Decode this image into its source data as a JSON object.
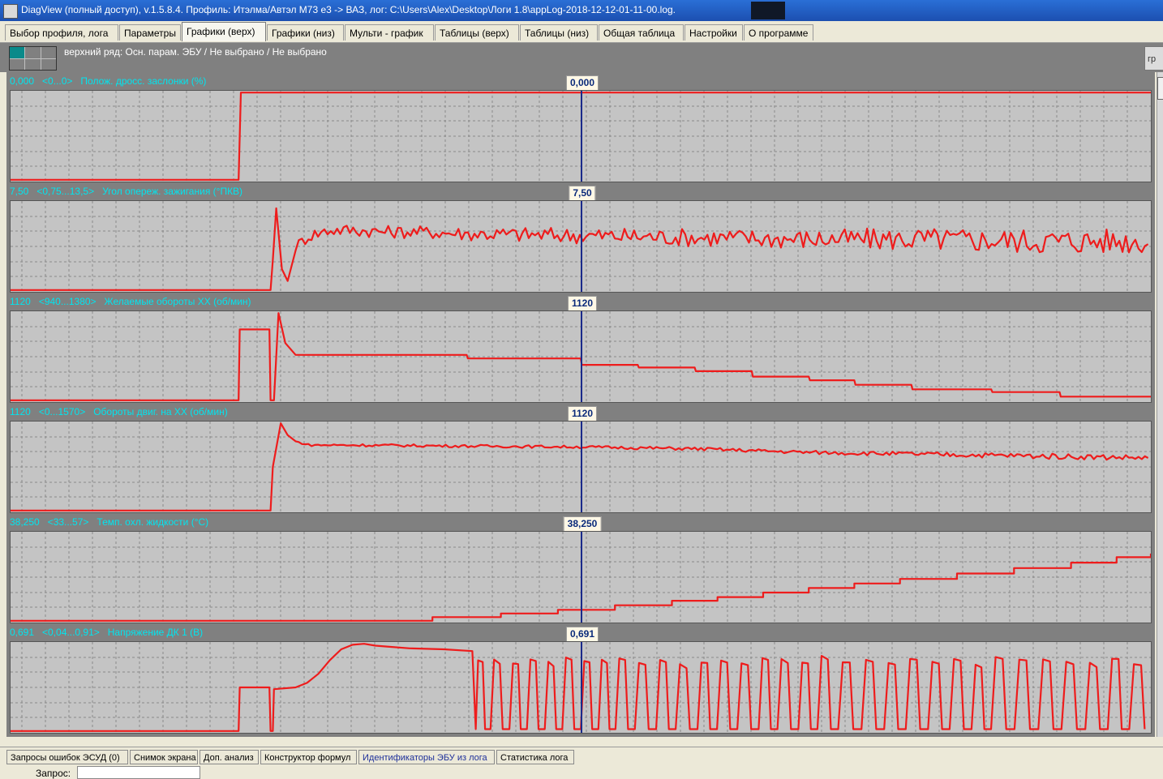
{
  "window": {
    "title": "DiagView (полный доступ), v.1.5.8.4. Профиль: Итэлма/Автэл M73 е3 -> ВАЗ,   лог: C:\\Users\\Alex\\Desktop\\Логи 1.8\\appLog-2018-12-12-01-11-00.log."
  },
  "tabs": [
    {
      "label": "Выбор профиля, лога"
    },
    {
      "label": "Параметры"
    },
    {
      "label": "Графики (верх)",
      "active": true
    },
    {
      "label": "Графики (низ)"
    },
    {
      "label": "Мульти - график"
    },
    {
      "label": "Таблицы (верх)"
    },
    {
      "label": "Таблицы (низ)"
    },
    {
      "label": "Общая таблица"
    },
    {
      "label": "Настройки"
    },
    {
      "label": "О программе"
    }
  ],
  "toolbar": {
    "row_label": "верхний ряд: Осн. парам. ЭБУ / Не выбрано / Не выбрано",
    "right_button": "гр"
  },
  "colors": {
    "trace": "#ee1c1c",
    "cursor": "#1a2a8a",
    "header_text": "#00e5ef",
    "plot_bg": "#c4c4c4",
    "grid": "#8a8a8a"
  },
  "chart_data": {
    "type": "line",
    "cursor_position": 0.5,
    "grid": true,
    "series": [
      {
        "value_text": "0,000",
        "range_text": "<0...0>",
        "name": "Полож. дросс. заслонки (%)",
        "cursor_value": "0,000",
        "x": [
          0,
          0.2,
          0.202,
          1
        ],
        "y": [
          0.02,
          0.02,
          0.98,
          0.98
        ]
      },
      {
        "value_text": "7,50",
        "range_text": "<0,75...13,5>",
        "name": "Угол опереж. зажигания (°ПКВ)",
        "cursor_value": "7,50",
        "x": [
          0,
          0.228,
          0.23,
          0.233,
          0.238,
          0.243,
          0.25,
          0.262,
          0.28,
          0.3,
          0.33,
          0.36,
          0.4,
          0.5,
          0.6,
          0.7,
          0.8,
          0.9,
          1
        ],
        "y": [
          0.02,
          0.02,
          0.35,
          0.92,
          0.25,
          0.12,
          0.5,
          0.62,
          0.68,
          0.68,
          0.66,
          0.66,
          0.64,
          0.62,
          0.6,
          0.58,
          0.58,
          0.56,
          0.56
        ],
        "noise": [
          0,
          0,
          0,
          0,
          0,
          0,
          0.06,
          0.07,
          0.07,
          0.07,
          0.07,
          0.07,
          0.08,
          0.09,
          0.1,
          0.11,
          0.13,
          0.14,
          0.14
        ]
      },
      {
        "value_text": "1120",
        "range_text": "<940...1380>",
        "name": "Желаемые обороты XX (об/мин)",
        "cursor_value": "1120",
        "x": [
          0,
          0.2,
          0.201,
          0.227,
          0.228,
          0.231,
          0.235,
          0.241,
          0.25,
          0.258,
          0.4,
          0.401,
          0.5,
          0.501,
          0.55,
          0.551,
          0.6,
          0.601,
          0.65,
          0.651,
          0.7,
          0.701,
          0.74,
          0.741,
          0.79,
          0.791,
          0.86,
          0.861,
          0.92,
          0.921,
          0.98,
          1
        ],
        "y": [
          0.02,
          0.02,
          0.8,
          0.8,
          0.02,
          0.02,
          0.98,
          0.65,
          0.52,
          0.52,
          0.52,
          0.48,
          0.48,
          0.41,
          0.41,
          0.38,
          0.38,
          0.34,
          0.34,
          0.28,
          0.28,
          0.24,
          0.24,
          0.19,
          0.19,
          0.14,
          0.14,
          0.11,
          0.11,
          0.06,
          0.06,
          0.06
        ]
      },
      {
        "value_text": "1120",
        "range_text": "<0...1570>",
        "name": "Обороты двиг. на XX (об/мин)",
        "cursor_value": "1120",
        "x": [
          0,
          0.228,
          0.23,
          0.237,
          0.243,
          0.25,
          0.262,
          0.3,
          0.4,
          0.5,
          0.6,
          0.7,
          0.8,
          0.9,
          1
        ],
        "y": [
          0.02,
          0.02,
          0.5,
          0.98,
          0.85,
          0.78,
          0.74,
          0.74,
          0.73,
          0.72,
          0.7,
          0.66,
          0.64,
          0.62,
          0.6
        ],
        "noise": [
          0,
          0,
          0,
          0,
          0,
          0.01,
          0.012,
          0.015,
          0.015,
          0.015,
          0.018,
          0.02,
          0.025,
          0.03,
          0.03
        ]
      },
      {
        "value_text": "38,250",
        "range_text": "<33...57>",
        "name": "Темп. охл. жидкости (°С)",
        "cursor_value": "38,250",
        "x": [
          0,
          0.2,
          0.339,
          0.37,
          0.43,
          0.48,
          0.53,
          0.58,
          0.62,
          0.66,
          0.7,
          0.74,
          0.78,
          0.83,
          0.88,
          0.93,
          0.97,
          1
        ],
        "y": [
          0.02,
          0.02,
          0.02,
          0.06,
          0.1,
          0.14,
          0.19,
          0.24,
          0.28,
          0.33,
          0.38,
          0.43,
          0.48,
          0.54,
          0.6,
          0.66,
          0.72,
          0.76
        ],
        "stairs": true
      },
      {
        "value_text": "0,691",
        "range_text": "<0,04...0,91>",
        "name": "Напряжение ДК 1 (В)",
        "cursor_value": "0,691",
        "x": [
          0,
          0.2,
          0.201,
          0.227,
          0.228,
          0.23,
          0.231,
          0.25,
          0.26,
          0.27,
          0.28,
          0.29,
          0.3,
          0.31,
          0.32,
          0.33,
          0.35,
          0.38,
          0.405,
          0.408
        ],
        "y": [
          0.02,
          0.02,
          0.5,
          0.5,
          0.02,
          0.02,
          0.48,
          0.5,
          0.55,
          0.65,
          0.8,
          0.92,
          0.97,
          0.98,
          0.96,
          0.95,
          0.93,
          0.92,
          0.9,
          0.04
        ],
        "oscillate_from": 0.408,
        "oscillate_period": 0.0155,
        "oscillate_high": 0.8,
        "oscillate_low": 0.04
      }
    ]
  },
  "bottom_tabs": [
    {
      "label": "Запросы ошибок ЭСУД (0)"
    },
    {
      "label": "Снимок экрана"
    },
    {
      "label": "Доп. анализ"
    },
    {
      "label": "Конструктор формул"
    },
    {
      "label": "Идентификаторы ЭБУ из лога",
      "highlight": true
    },
    {
      "label": "Статистика лога"
    }
  ],
  "request": {
    "label": "Запрос:"
  }
}
